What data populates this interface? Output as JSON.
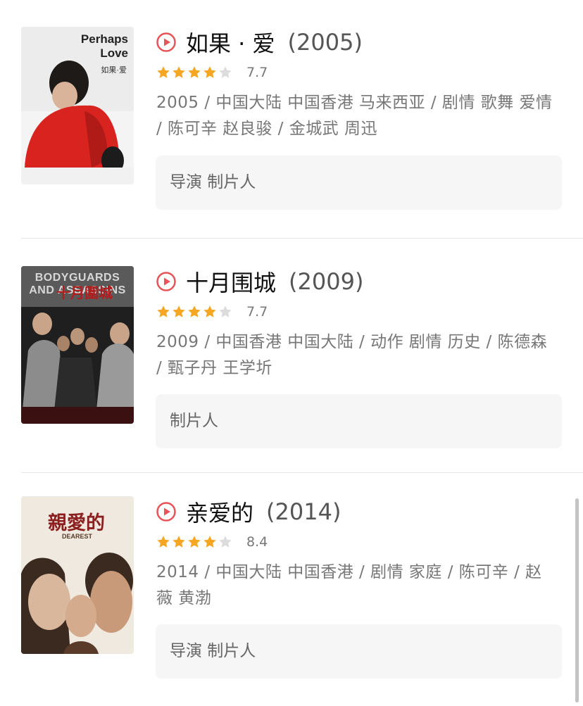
{
  "movies": [
    {
      "title": "如果 · 爱",
      "year": "(2005)",
      "stars": 4,
      "score": "7.7",
      "meta": "2005 / 中国大陆 中国香港 马来西亚 / 剧情 歌舞 爱情 / 陈可辛 赵良骏 / 金城武 周迅",
      "credits": "导演 制片人",
      "poster": {
        "title_en": "Perhaps Love",
        "title_cn": "如果·爱",
        "colors": [
          "#e7e7e7",
          "#d8231f",
          "#1c1c1c"
        ]
      }
    },
    {
      "title": "十月围城",
      "year": "(2009)",
      "stars": 4,
      "score": "7.7",
      "meta": "2009 / 中国香港 中国大陆 / 动作 剧情 历史 / 陈德森 / 甄子丹 王学圻",
      "credits": "制片人",
      "poster": {
        "title_en": "BODYGUARDS AND ASSASSINS",
        "title_cn": "十月圍城",
        "colors": [
          "#1e1e1e",
          "#8a8a8a",
          "#b31c1c"
        ]
      }
    },
    {
      "title": "亲爱的",
      "year": "(2014)",
      "stars": 4,
      "score": "8.4",
      "meta": "2014 / 中国大陆 中国香港 / 剧情 家庭 / 陈可辛 / 赵薇 黄渤",
      "credits": "导演 制片人",
      "poster": {
        "title_en": "DEAREST",
        "title_cn": "親愛的",
        "colors": [
          "#efe9df",
          "#a66b4c",
          "#3a2a20"
        ]
      }
    }
  ],
  "icons": {
    "play": "play-circle-icon",
    "star_full": "star-icon",
    "star_empty": "star-empty-icon"
  },
  "colors": {
    "accent": "#e6545a",
    "star": "#f5a623",
    "star_empty": "#dcdcdc"
  }
}
